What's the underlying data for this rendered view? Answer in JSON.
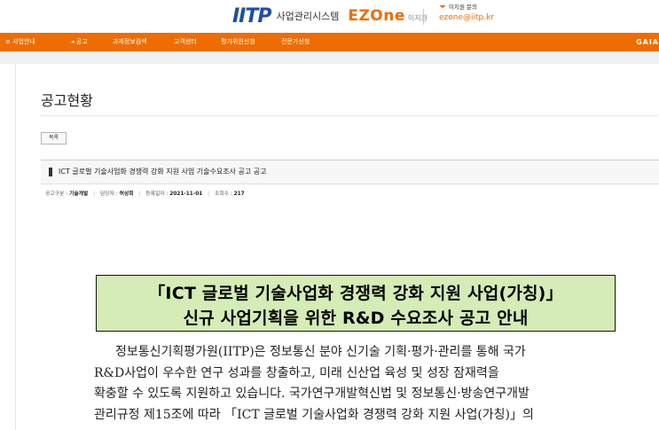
{
  "header": {
    "logo_text": "IITP",
    "system_name": "사업관리시스템",
    "ezone_name": "EZOne",
    "ezone_sub": "이지원",
    "contact_label": "이지원 문의",
    "contact_email": "ezone@iitp.kr"
  },
  "nav": {
    "items": [
      "사업안내",
      "공고",
      "과제정보검색",
      "고객센터",
      "평가위원신청",
      "전문가신청"
    ],
    "brand": "GAIA"
  },
  "page": {
    "title": "공고현황",
    "list_button": "목록"
  },
  "post": {
    "title": "ICT 글로벌 기술사업화 경쟁력 강화 지원 사업 기술수요조사 공고 공고",
    "meta": {
      "category_label": "공고구분 :",
      "category_value": "기술개발",
      "manager_label": "담당자 :",
      "manager_value": "허상희",
      "date_label": "등록일자 :",
      "date_value": "2021-11-01",
      "views_label": "조회수 :",
      "views_value": "217"
    }
  },
  "announcement": {
    "line1": "「ICT 글로벌 기술사업화 경쟁력 강화 지원 사업(가칭)」",
    "line2": "신규 사업기획을 위한 R&D 수요조사 공고 안내",
    "box_color": "#d5ecb6"
  },
  "body": {
    "lines": [
      "정보통신기획평가원(IITP)은 정보통신 분야 신기술 기획·평가·관리를 통해 국가",
      "R&D사업이 우수한 연구 성과를 창출하고, 미래 신산업 육성 및 성장 잠재력을",
      "확충할 수 있도록 지원하고 있습니다. 국가연구개발혁신법 및 정보통신·방송연구개발",
      "관리규정 제15조에 따라 「ICT 글로벌 기술사업화 경쟁력 강화 지원 사업(가칭)」의"
    ]
  },
  "colors": {
    "accent": "#ef6c00",
    "brand_blue": "#1f4fa3"
  }
}
